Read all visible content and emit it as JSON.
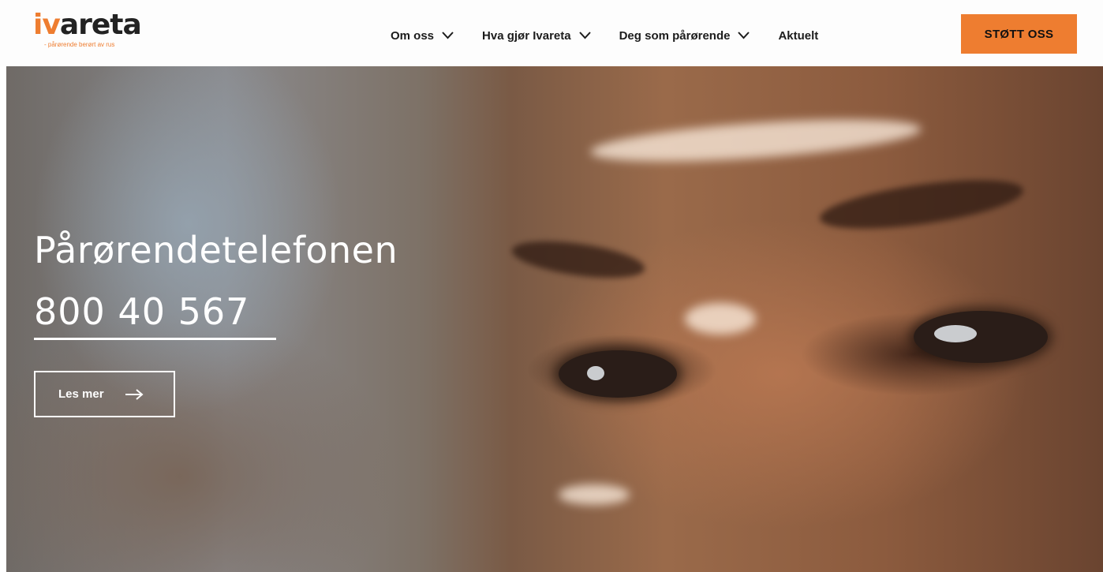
{
  "header": {
    "logo": {
      "prefix": "iv",
      "rest": "areta",
      "tagline": "- pårørende berørt av rus"
    },
    "nav": [
      {
        "label": "Om oss",
        "dropdown": true
      },
      {
        "label": "Hva gjør Ivareta",
        "dropdown": true
      },
      {
        "label": "Deg som pårørende",
        "dropdown": true
      },
      {
        "label": "Aktuelt",
        "dropdown": false
      }
    ],
    "cta_label": "STØTT OSS"
  },
  "hero": {
    "title": "Pårørendetelefonen",
    "phone": "800 40 567",
    "button_label": "Les mer",
    "button_icon": "arrow-right-icon"
  },
  "colors": {
    "accent": "#ee7d30",
    "text_dark": "#1c1c1c",
    "hero_text": "#ffffff"
  }
}
